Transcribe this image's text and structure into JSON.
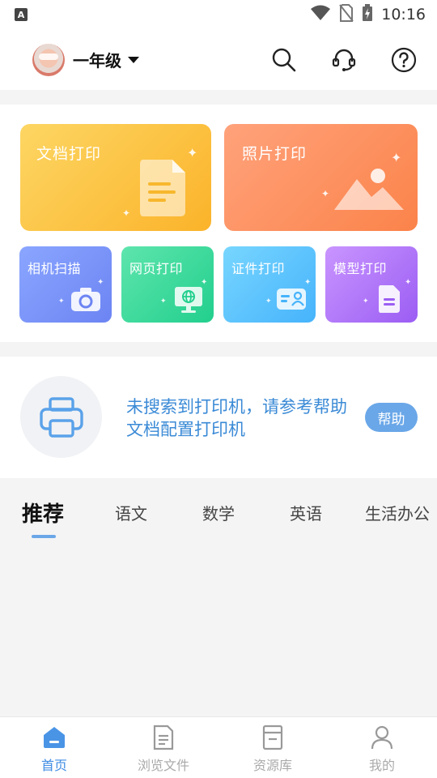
{
  "status_bar": {
    "app_badge": "A",
    "time": "10:16"
  },
  "header": {
    "grade": "一年级"
  },
  "cards": {
    "doc_print": "文档打印",
    "photo_print": "照片打印",
    "camera_scan": "相机扫描",
    "web_print": "网页打印",
    "id_print": "证件打印",
    "model_print": "模型打印"
  },
  "printer_prompt": {
    "message": "未搜索到打印机，请参考帮助文档配置打印机",
    "help_label": "帮助"
  },
  "tabs": [
    "推荐",
    "语文",
    "数学",
    "英语",
    "生活办公"
  ],
  "bottom_nav": [
    "首页",
    "浏览文件",
    "资源库",
    "我的"
  ],
  "colors": {
    "accent": "#3f8ce3",
    "help_button": "#6aa7e8",
    "prompt_text": "#3a8ad6"
  }
}
